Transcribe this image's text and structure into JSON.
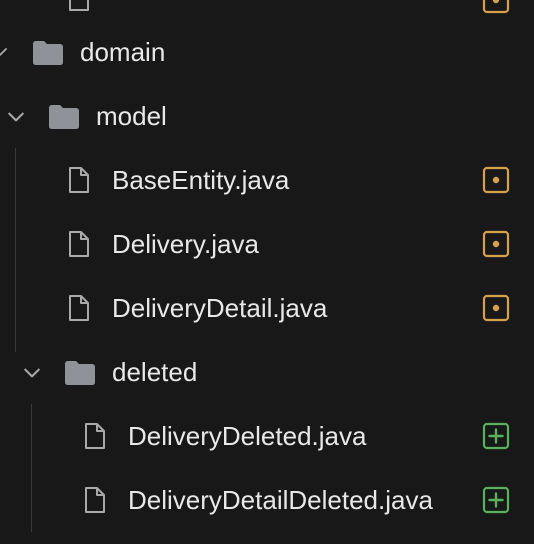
{
  "explorer": {
    "items": [
      {
        "kind": "file",
        "label": "",
        "status": "modified"
      },
      {
        "kind": "folder",
        "label": "domain",
        "expanded": true
      },
      {
        "kind": "folder",
        "label": "model",
        "expanded": true
      },
      {
        "kind": "file",
        "label": "BaseEntity.java",
        "status": "modified"
      },
      {
        "kind": "file",
        "label": "Delivery.java",
        "status": "modified"
      },
      {
        "kind": "file",
        "label": "DeliveryDetail.java",
        "status": "modified"
      },
      {
        "kind": "folder",
        "label": "deleted",
        "expanded": true
      },
      {
        "kind": "file",
        "label": "DeliveryDeleted.java",
        "status": "added"
      },
      {
        "kind": "file",
        "label": "DeliveryDetailDeleted.java",
        "status": "added"
      }
    ]
  },
  "colors": {
    "background": "#181818",
    "text": "#e8e8e8",
    "icon": "#a9a9a9",
    "folder": "#8f9299",
    "modified": "#d7a04a",
    "added": "#56b35a",
    "guide": "#3a3a3a"
  },
  "icons": {
    "chevron": "chevron-down-icon",
    "folder": "folder-icon",
    "file": "file-icon",
    "modified": "modified-badge-icon",
    "added": "added-badge-icon"
  }
}
